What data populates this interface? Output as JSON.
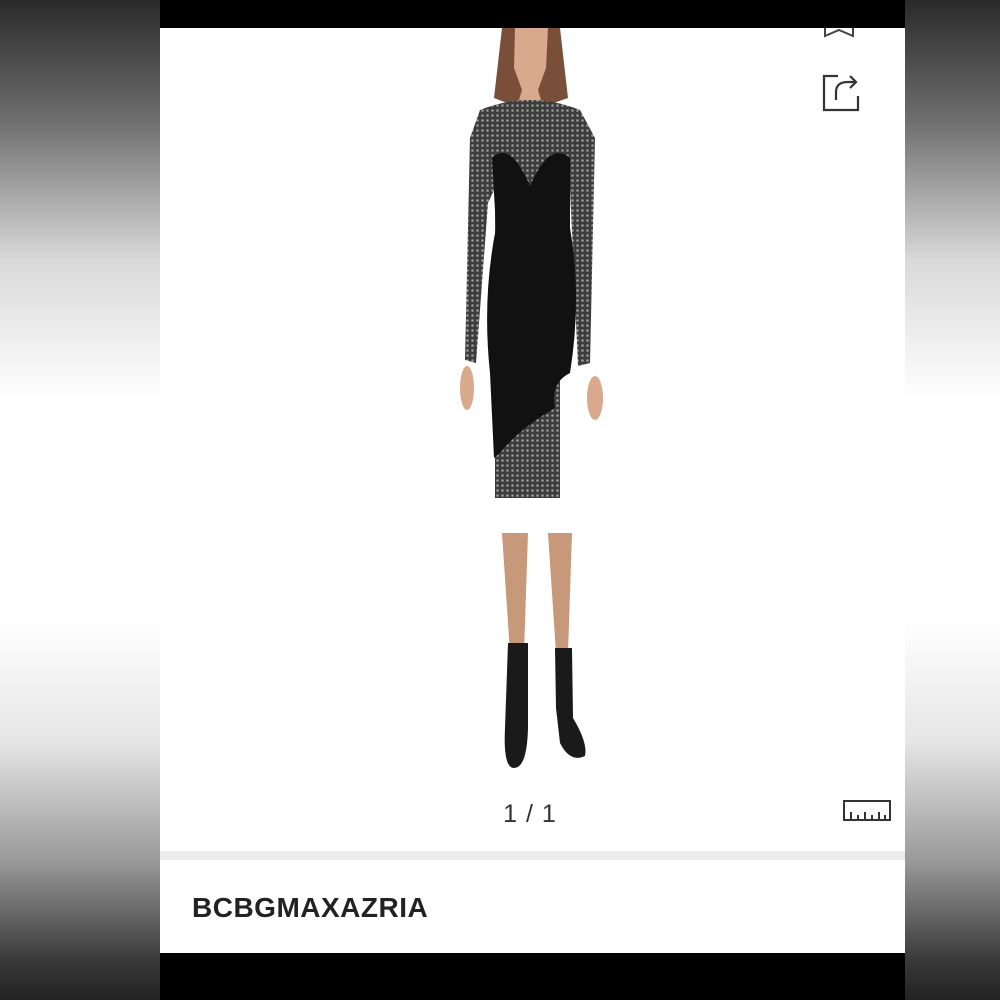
{
  "pager": {
    "text": "1 / 1"
  },
  "product": {
    "brand": "BCBGMAXAZRIA"
  },
  "icons": {
    "bookmark": "bookmark-icon",
    "share": "share-icon",
    "size_guide": "ruler-icon"
  },
  "colors": {
    "background": "#ffffff",
    "frame": "#000000",
    "divider": "#ececec",
    "text": "#222222"
  }
}
